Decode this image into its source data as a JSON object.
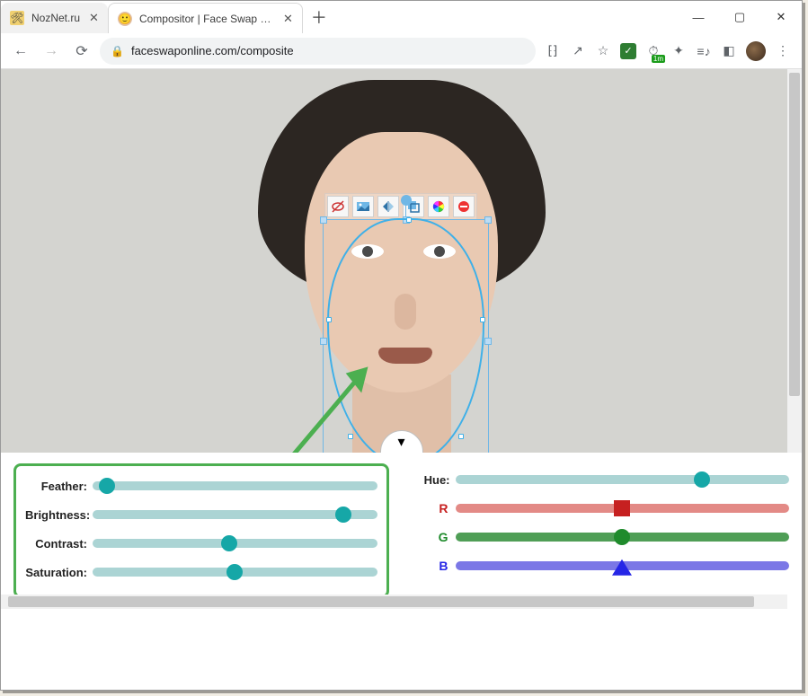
{
  "tabs": [
    {
      "title": "NozNet.ru",
      "active": false
    },
    {
      "title": "Compositor | Face Swap Online",
      "active": true
    }
  ],
  "url": "faceswaponline.com/composite",
  "ext_badge": "1m",
  "toolbar": {
    "clear": "clear-selection",
    "fliph": "flip-horizontal",
    "flipv": "flip-vertical",
    "copy": "overlay",
    "color": "color-adjust",
    "delete": "delete"
  },
  "sliders_left": {
    "feather": {
      "label": "Feather:",
      "value": 5
    },
    "brightness": {
      "label": "Brightness:",
      "value": 88
    },
    "contrast": {
      "label": "Contrast:",
      "value": 48
    },
    "saturation": {
      "label": "Saturation:",
      "value": 50
    }
  },
  "sliders_right": {
    "hue": {
      "label": "Hue:",
      "value": 74
    },
    "r": {
      "label": "R",
      "value": 50
    },
    "g": {
      "label": "G",
      "value": 50
    },
    "b": {
      "label": "B",
      "value": 50
    }
  },
  "expand_icon": "▾"
}
